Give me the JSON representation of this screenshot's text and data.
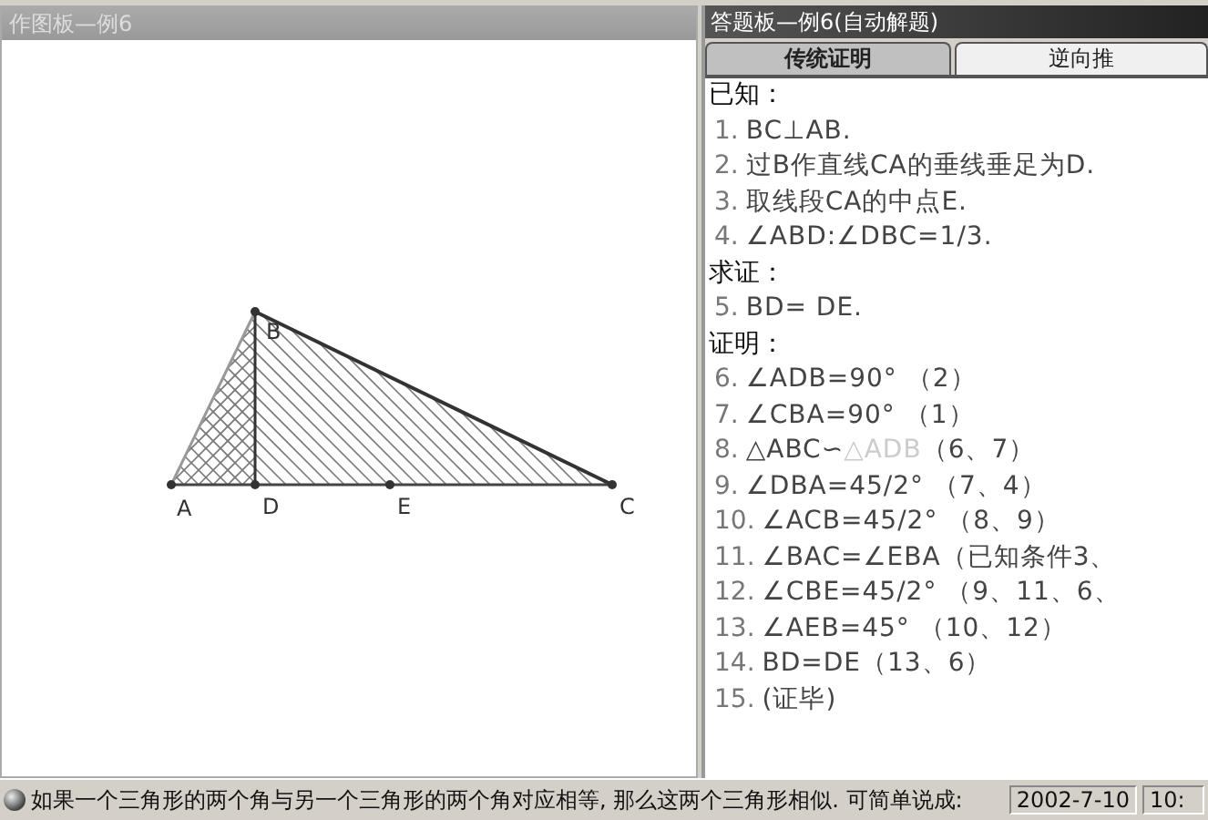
{
  "drawing_panel": {
    "title": "作图板—例6",
    "points": [
      {
        "label": "A"
      },
      {
        "label": "B"
      },
      {
        "label": "D"
      },
      {
        "label": "E"
      },
      {
        "label": "C"
      }
    ]
  },
  "answer_panel": {
    "title": "答题板—例6(自动解题)",
    "tabs": [
      {
        "label": "传统证明",
        "selected": true
      },
      {
        "label": "逆向推",
        "selected": false
      }
    ],
    "lines": [
      {
        "kind": "heading",
        "text": "已知："
      },
      {
        "kind": "step",
        "number": "1.",
        "parts": [
          {
            "text": "BC⊥AB.",
            "faded": false
          }
        ]
      },
      {
        "kind": "step",
        "number": "2.",
        "parts": [
          {
            "text": "过B作直线CA的垂线垂足为D.",
            "faded": false
          }
        ]
      },
      {
        "kind": "step",
        "number": "3.",
        "parts": [
          {
            "text": "取线段CA的中点E.",
            "faded": false
          }
        ]
      },
      {
        "kind": "step",
        "number": "4.",
        "parts": [
          {
            "text": "∠ABD:∠DBC=1/3.",
            "faded": false
          }
        ]
      },
      {
        "kind": "heading",
        "text": "求证："
      },
      {
        "kind": "step",
        "number": "5.",
        "parts": [
          {
            "text": "BD= DE.",
            "faded": false
          }
        ]
      },
      {
        "kind": "heading",
        "text": "证明："
      },
      {
        "kind": "step",
        "number": "6.",
        "parts": [
          {
            "text": "∠ADB=90° （2）",
            "faded": false
          }
        ]
      },
      {
        "kind": "step",
        "number": "7.",
        "parts": [
          {
            "text": "∠CBA=90° （1）",
            "faded": false
          }
        ]
      },
      {
        "kind": "step",
        "number": "8.",
        "parts": [
          {
            "text": "△ABC∽",
            "faded": false
          },
          {
            "text": "△ADB",
            "faded": true
          },
          {
            "text": "（6、7）",
            "faded": false
          }
        ]
      },
      {
        "kind": "step",
        "number": "9.",
        "parts": [
          {
            "text": "∠DBA=45/2° （7、4）",
            "faded": false
          }
        ]
      },
      {
        "kind": "step",
        "number": "10.",
        "parts": [
          {
            "text": "∠ACB=45/2° （8、9）",
            "faded": false
          }
        ]
      },
      {
        "kind": "step",
        "number": "11.",
        "parts": [
          {
            "text": "∠BAC=∠EBA（已知条件3、",
            "faded": false
          }
        ]
      },
      {
        "kind": "step",
        "number": "12.",
        "parts": [
          {
            "text": "∠CBE=45/2° （9、11、6、",
            "faded": false
          }
        ]
      },
      {
        "kind": "step",
        "number": "13.",
        "parts": [
          {
            "text": "∠AEB=45° （10、12）",
            "faded": false
          }
        ]
      },
      {
        "kind": "step",
        "number": "14.",
        "parts": [
          {
            "text": "BD=DE（13、6）",
            "faded": false
          }
        ]
      },
      {
        "kind": "step",
        "number": "15.",
        "parts": [
          {
            "text": "(证毕)",
            "faded": false
          }
        ]
      }
    ]
  },
  "status_bar": {
    "message": "如果一个三角形的两个角与另一个三角形的两个角对应相等, 那么这两个三角形相似. 可简单说成:",
    "date": "2002-7-10",
    "time": "10:"
  }
}
